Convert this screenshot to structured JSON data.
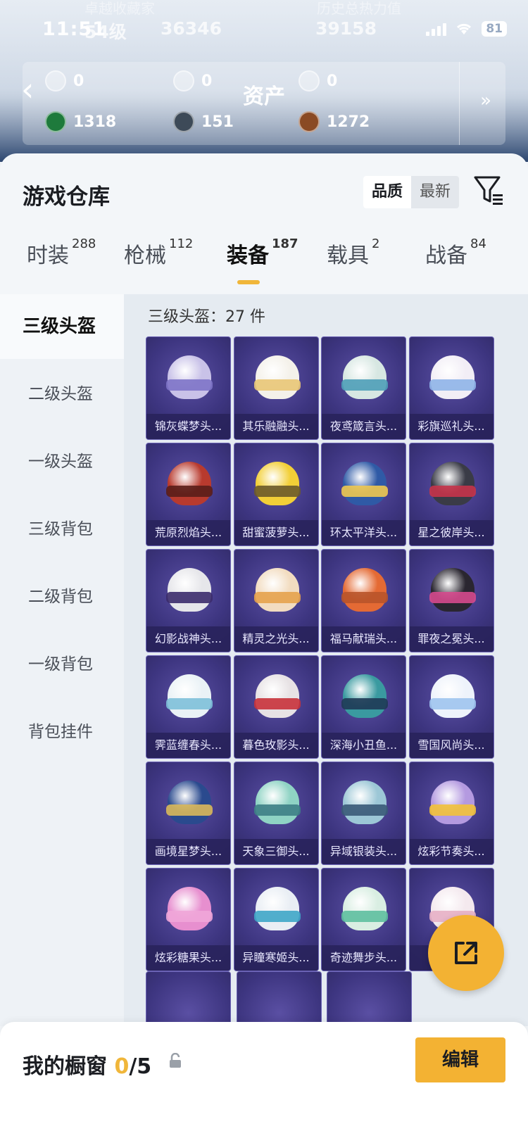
{
  "status_bar": {
    "time": "11:51",
    "battery": "81"
  },
  "header_bg": {
    "level_text": "54级",
    "points": "36346",
    "power": "39158",
    "badge_text": "卓越收藏家",
    "history_text": "历史总热力值"
  },
  "assets": {
    "title": "资产",
    "items": [
      {
        "value": "0",
        "icon": "card-icon"
      },
      {
        "value": "0",
        "icon": "coin-icon"
      },
      {
        "value": "0",
        "icon": "gold-coin-icon"
      },
      {
        "value": "1318",
        "icon": "gem-icon"
      },
      {
        "value": "151",
        "icon": "dark-token-icon"
      },
      {
        "value": "1272",
        "icon": "bronze-token-icon"
      }
    ]
  },
  "warehouse": {
    "title": "游戏仓库",
    "sort_options": [
      "品质",
      "最新"
    ],
    "active_sort": "品质"
  },
  "tabs": [
    {
      "label": "时装",
      "count": "288"
    },
    {
      "label": "枪械",
      "count": "112"
    },
    {
      "label": "装备",
      "count": "187"
    },
    {
      "label": "载具",
      "count": "2"
    },
    {
      "label": "战备",
      "count": "84"
    }
  ],
  "sidebar": [
    "三级头盔",
    "二级头盔",
    "一级头盔",
    "三级背包",
    "二级背包",
    "一级背包",
    "背包挂件"
  ],
  "content": {
    "count_label": "三级头盔：27 件",
    "items": [
      {
        "name": "锦灰蝶梦头...",
        "color": "#c9c2e8",
        "visor": "#7e74c8"
      },
      {
        "name": "其乐融融头...",
        "color": "#f4f1ea",
        "visor": "#e9c677"
      },
      {
        "name": "夜鸢箴言头...",
        "color": "#d7e7e2",
        "visor": "#4f9fb8"
      },
      {
        "name": "彩旗巡礼头...",
        "color": "#f2eef6",
        "visor": "#8fb4e8"
      },
      {
        "name": "荒原烈焰头...",
        "color": "#b83a2e",
        "visor": "#5a1e1a"
      },
      {
        "name": "甜蜜菠萝头...",
        "color": "#f2cf37",
        "visor": "#6b5a2a"
      },
      {
        "name": "环太平洋头...",
        "color": "#2f5aa6",
        "visor": "#f0c850"
      },
      {
        "name": "星之彼岸头...",
        "color": "#3a3b46",
        "visor": "#c7344a"
      },
      {
        "name": "幻影战神头...",
        "color": "#e6e6ea",
        "visor": "#3b2b6b"
      },
      {
        "name": "精灵之光头...",
        "color": "#f2dcc0",
        "visor": "#e6a24c"
      },
      {
        "name": "福马献瑞头...",
        "color": "#e46a34",
        "visor": "#b8542a"
      },
      {
        "name": "罪夜之冕头...",
        "color": "#2a2630",
        "visor": "#d64a8e"
      },
      {
        "name": "霁蓝缠春头...",
        "color": "#eaf2f6",
        "visor": "#7ec0d9"
      },
      {
        "name": "暮色玫影头...",
        "color": "#e7e2e4",
        "visor": "#c8323a"
      },
      {
        "name": "深海小丑鱼...",
        "color": "#3a9aa0",
        "visor": "#1f3a55"
      },
      {
        "name": "雪国风尚头...",
        "color": "#eef3fb",
        "visor": "#9fc4ee"
      },
      {
        "name": "画境星梦头...",
        "color": "#2a4a8e",
        "visor": "#d9b85a"
      },
      {
        "name": "天象三御头...",
        "color": "#8fd3c4",
        "visor": "#3e7f86"
      },
      {
        "name": "异域银装头...",
        "color": "#9cc7d6",
        "visor": "#3a5a78"
      },
      {
        "name": "炫彩节奏头...",
        "color": "#b49ae0",
        "visor": "#f2c23a"
      },
      {
        "name": "炫彩糖果头...",
        "color": "#e78fcf",
        "visor": "#f0a6d8"
      },
      {
        "name": "异瞳寒姬头...",
        "color": "#e9eef4",
        "visor": "#3fa6c8"
      },
      {
        "name": "奇迹舞步头...",
        "color": "#d9eee2",
        "visor": "#5ebfa0"
      },
      {
        "name": "粉黛...",
        "color": "#f4e9ee",
        "visor": "#e7b0c5"
      }
    ]
  },
  "showcase": {
    "label": "我的橱窗",
    "used": "0",
    "total": "/5",
    "edit_label": "编辑"
  }
}
